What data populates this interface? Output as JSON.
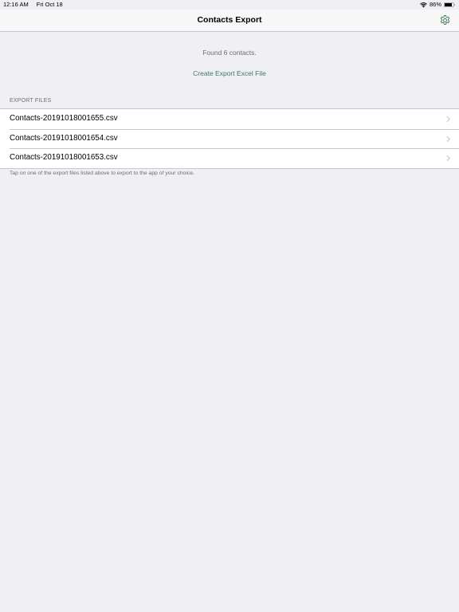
{
  "status_bar": {
    "time": "12:16 AM",
    "date": "Fri Oct 18",
    "battery_percent": "86%",
    "battery_level": 0.86
  },
  "nav": {
    "title": "Contacts Export",
    "settings_icon": "gear-icon"
  },
  "summary": {
    "found_text": "Found 6 contacts.",
    "create_button_label": "Create Export Excel File"
  },
  "export_files": {
    "header": "EXPORT FILES",
    "files": [
      "Contacts-20191018001655.csv",
      "Contacts-20191018001654.csv",
      "Contacts-20191018001653.csv"
    ],
    "footer": "Tap on one of the export files listed above to export to the app of your choice."
  },
  "colors": {
    "accent": "#3e7a58",
    "background": "#efeff4",
    "secondary_text": "#6d6d72",
    "separator": "#c8c7cc"
  }
}
